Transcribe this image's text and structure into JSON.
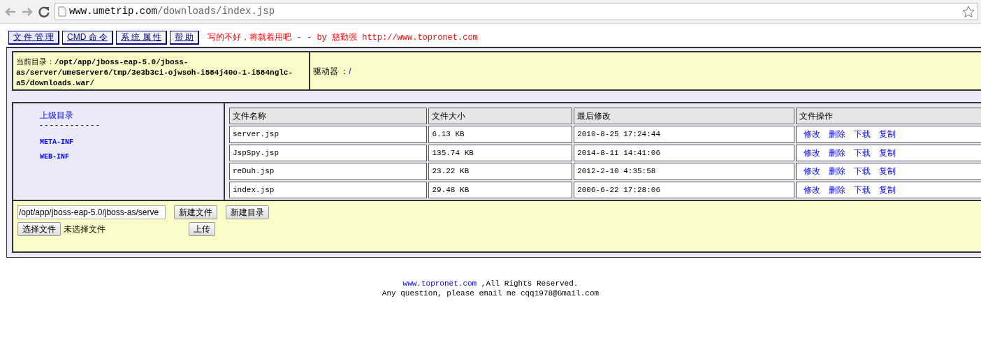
{
  "browser": {
    "url_host": "www.umetrip.com",
    "url_path": "/downloads/index.jsp"
  },
  "menu": [
    {
      "label": "文 件 管 理"
    },
    {
      "label": "CMD 命 令"
    },
    {
      "label": "系 统 属 性"
    },
    {
      "label": "帮 助"
    }
  ],
  "slogan": "写的不好，将就着用吧 - - by 慈勤强 http://www.topronet.com",
  "current_dir": {
    "label": "当前目录：",
    "path": "/opt/app/jboss-eap-5.0/jboss-as/server/umeServer6/tmp/3e3b3ci-ojwsoh-i584j40o-1-i584nglc-a5/downloads.war/"
  },
  "drive": {
    "label": "驱动器 ：",
    "value": "/"
  },
  "sidebar": {
    "parent_link": "上级目录",
    "separator": "- - - - - - - - - - - -",
    "dirs": [
      "META-INF",
      "WEB-INF"
    ]
  },
  "table": {
    "columns": [
      "文件名称",
      "文件大小",
      "最后修改",
      "文件操作"
    ],
    "rows": [
      {
        "name": "server.jsp",
        "size": "6.13 KB",
        "modified": "2010-8-25 17:24:44",
        "actions": [
          "修改",
          "删除",
          "下载",
          "复制"
        ]
      },
      {
        "name": "JspSpy.jsp",
        "size": "135.74 KB",
        "modified": "2014-8-11 14:41:06",
        "actions": [
          "修改",
          "删除",
          "下载",
          "复制"
        ]
      },
      {
        "name": "reDuh.jsp",
        "size": "23.22 KB",
        "modified": "2012-2-10 4:35:58",
        "actions": [
          "修改",
          "删除",
          "下载",
          "复制"
        ]
      },
      {
        "name": "index.jsp",
        "size": "29.48 KB",
        "modified": "2006-6-22 17:28:06",
        "actions": [
          "修改",
          "删除",
          "下载",
          "复制"
        ]
      }
    ]
  },
  "form": {
    "path_value": "/opt/app/jboss-eap-5.0/jboss-as/serve",
    "new_file": "新建文件",
    "new_dir": "新建目录",
    "choose_file": "选择文件",
    "no_file": "未选择文件",
    "upload": "上传"
  },
  "footer": {
    "link": "www.topronet.com",
    "rights": ",All Rights Reserved.",
    "contact": "Any question, please email me cqq1978@Gmail.com"
  }
}
